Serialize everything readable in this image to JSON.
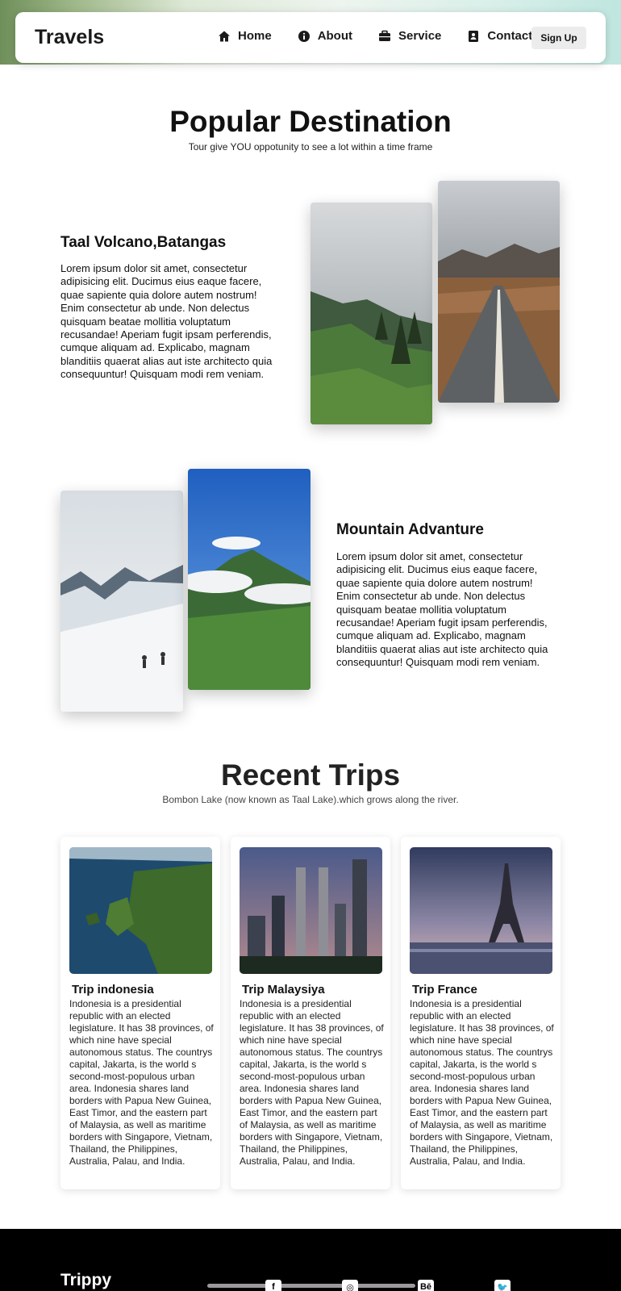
{
  "nav": {
    "brand": "Travels",
    "items": [
      {
        "label": "Home",
        "icon": "home-icon"
      },
      {
        "label": "About",
        "icon": "info-icon"
      },
      {
        "label": "Service",
        "icon": "briefcase-icon"
      },
      {
        "label": "Contact",
        "icon": "contact-card-icon"
      }
    ],
    "signup": "Sign Up"
  },
  "popular": {
    "title": "Popular Destination",
    "subtitle": "Tour give YOU oppotunity to see a lot within a time frame"
  },
  "destinations": [
    {
      "title": "Taal Volcano,Batangas",
      "text": "Lorem ipsum dolor sit amet, consectetur adipisicing elit. Ducimus eius eaque facere, quae sapiente quia dolore autem nostrum! Enim consectetur ab unde. Non delectus quisquam beatae mollitia voluptatum recusandae! Aperiam fugit ipsam perferendis, cumque aliquam ad. Explicabo, magnam blanditiis quaerat alias aut iste architecto quia consequuntur! Quisquam modi rem veniam."
    },
    {
      "title": "Mountain Advanture",
      "text": "Lorem ipsum dolor sit amet, consectetur adipisicing elit. Ducimus eius eaque facere, quae sapiente quia dolore autem nostrum! Enim consectetur ab unde. Non delectus quisquam beatae mollitia voluptatum recusandae! Aperiam fugit ipsam perferendis, cumque aliquam ad. Explicabo, magnam blanditiis quaerat alias aut iste architecto quia consequuntur! Quisquam modi rem veniam."
    }
  ],
  "recent": {
    "title": "Recent Trips",
    "subtitle": "Bombon Lake (now known as Taal Lake).which grows along the river."
  },
  "trips": [
    {
      "title": "Trip indonesia",
      "text": "Indonesia is a presidential republic with an elected legislature. It has 38 provinces, of which nine have special autonomous status. The countrys capital, Jakarta, is the world s second-most-populous urban area. Indonesia shares land borders with Papua New Guinea, East Timor, and the eastern part of Malaysia, as well as maritime borders with Singapore, Vietnam, Thailand, the Philippines, Australia, Palau, and India."
    },
    {
      "title": "Trip Malaysiya",
      "text": "Indonesia is a presidential republic with an elected legislature. It has 38 provinces, of which nine have special autonomous status. The countrys capital, Jakarta, is the world s second-most-populous urban area. Indonesia shares land borders with Papua New Guinea, East Timor, and the eastern part of Malaysia, as well as maritime borders with Singapore, Vietnam, Thailand, the Philippines, Australia, Palau, and India."
    },
    {
      "title": "Trip France",
      "text": "Indonesia is a presidential republic with an elected legislature. It has 38 provinces, of which nine have special autonomous status. The countrys capital, Jakarta, is the world s second-most-populous urban area. Indonesia shares land borders with Papua New Guinea, East Timor, and the eastern part of Malaysia, as well as maritime borders with Singapore, Vietnam, Thailand, the Philippines, Australia, Palau, and India."
    }
  ],
  "footer": {
    "brand": "Trippy",
    "social": [
      {
        "icon": "facebook-icon",
        "glyph": "f"
      },
      {
        "icon": "instagram-icon",
        "glyph": "◎"
      },
      {
        "icon": "behance-icon",
        "glyph": "Bē"
      },
      {
        "icon": "twitter-icon",
        "glyph": "🐦"
      }
    ]
  }
}
